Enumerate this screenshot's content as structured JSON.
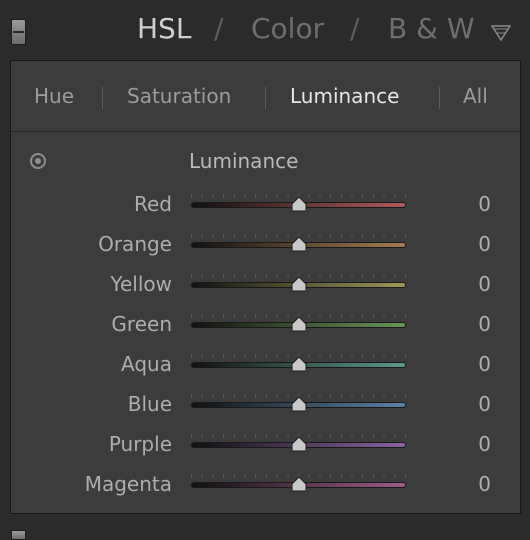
{
  "header": {
    "tabs": [
      {
        "label": "HSL",
        "active": true
      },
      {
        "label": "Color",
        "active": false
      },
      {
        "label": "B & W",
        "active": false
      }
    ],
    "separator": "/"
  },
  "subtabs": [
    {
      "label": "Hue",
      "active": false
    },
    {
      "label": "Saturation",
      "active": false
    },
    {
      "label": "Luminance",
      "active": true
    },
    {
      "label": "All",
      "active": false
    }
  ],
  "section": {
    "title": "Luminance"
  },
  "sliders": [
    {
      "label": "Red",
      "value": "0",
      "color": "#b05a5a"
    },
    {
      "label": "Orange",
      "value": "0",
      "color": "#a77c4e"
    },
    {
      "label": "Yellow",
      "value": "0",
      "color": "#9d9a57"
    },
    {
      "label": "Green",
      "value": "0",
      "color": "#6b9656"
    },
    {
      "label": "Aqua",
      "value": "0",
      "color": "#5a9c8c"
    },
    {
      "label": "Blue",
      "value": "0",
      "color": "#5a82a8"
    },
    {
      "label": "Purple",
      "value": "0",
      "color": "#8a62a3"
    },
    {
      "label": "Magenta",
      "value": "0",
      "color": "#a05a8a"
    }
  ],
  "slider_range": {
    "min": -100,
    "max": 100
  }
}
